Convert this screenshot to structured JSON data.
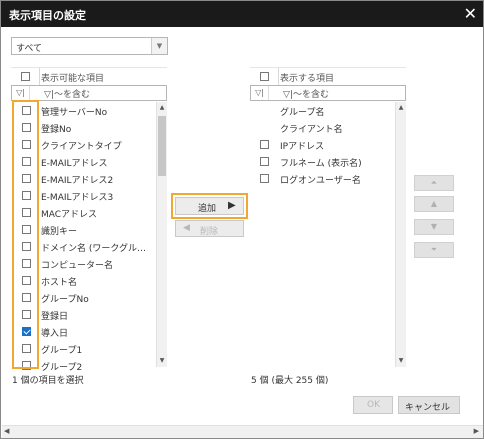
{
  "dialog": {
    "title": "表示項目の設定",
    "close_glyph": "✕"
  },
  "view_select": {
    "value": "すべて"
  },
  "available": {
    "header": "表示可能な項目",
    "filter_placeholder": "〜を含む",
    "items": [
      {
        "label": "管理サーバーNo",
        "checked": false
      },
      {
        "label": "登録No",
        "checked": false
      },
      {
        "label": "クライアントタイプ",
        "checked": false
      },
      {
        "label": "E-MAILアドレス",
        "checked": false
      },
      {
        "label": "E-MAILアドレス2",
        "checked": false
      },
      {
        "label": "E-MAILアドレス3",
        "checked": false
      },
      {
        "label": "MACアドレス",
        "checked": false
      },
      {
        "label": "識別キー",
        "checked": false
      },
      {
        "label": "ドメイン名 (ワークグループ名)",
        "checked": false
      },
      {
        "label": "コンピューター名",
        "checked": false
      },
      {
        "label": "ホスト名",
        "checked": false
      },
      {
        "label": "グループNo",
        "checked": false
      },
      {
        "label": "登録日",
        "checked": false
      },
      {
        "label": "導入日",
        "checked": true
      },
      {
        "label": "グループ1",
        "checked": false
      },
      {
        "label": "グループ2",
        "checked": false
      }
    ],
    "status": "1 個の項目を選択"
  },
  "actions": {
    "add_label": "追加",
    "add_glyph": "▶",
    "remove_label": "削除",
    "remove_glyph": "◀"
  },
  "displayed": {
    "header": "表示する項目",
    "filter_placeholder": "〜を含む",
    "items": [
      {
        "label": "グループ名",
        "has_checkbox": false
      },
      {
        "label": "クライアント名",
        "has_checkbox": false
      },
      {
        "label": "IPアドレス",
        "has_checkbox": true
      },
      {
        "label": "フルネーム (表示名)",
        "has_checkbox": true
      },
      {
        "label": "ログオンユーザー名",
        "has_checkbox": true
      }
    ],
    "status": "5 個 (最大 255 個)"
  },
  "order_buttons": [
    "move-top",
    "move-up",
    "move-down",
    "move-bottom"
  ],
  "footer": {
    "ok_label": "OK",
    "cancel_label": "キャンセル"
  },
  "colors": {
    "highlight": "#f0a830",
    "titlebar": "#1a1a1a",
    "check": "#1a6fc9"
  }
}
